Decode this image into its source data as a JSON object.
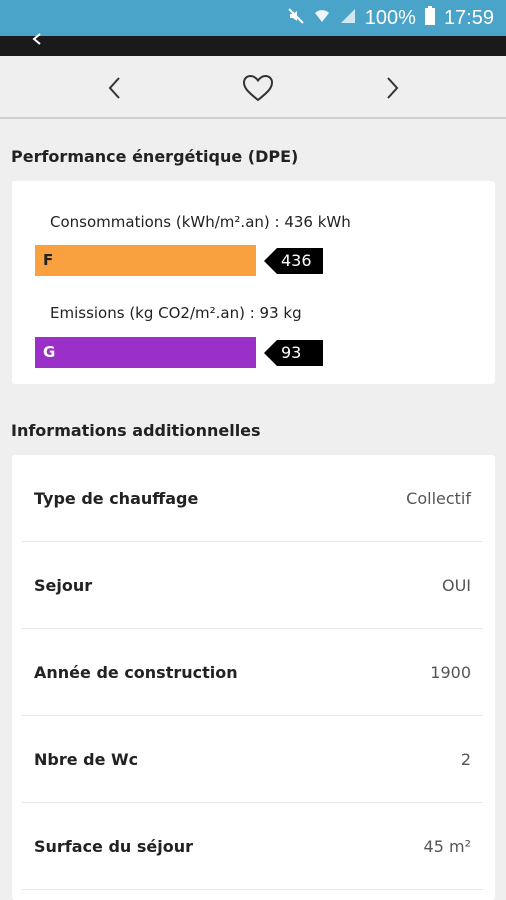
{
  "status_bar": {
    "battery_text": "100%",
    "time": "17:59"
  },
  "icons": {
    "mute": "mute-icon",
    "wifi": "wifi-icon",
    "signal": "signal-icon",
    "battery": "battery-icon",
    "back": "back-arrow-icon",
    "prev": "chevron-left-icon",
    "favorite": "heart-icon",
    "next": "chevron-right-icon"
  },
  "colors": {
    "status_bar": "#4aa3c8",
    "energy_class_F": "#f9a03f",
    "emission_class_G": "#9b30c9"
  },
  "dpe": {
    "title": "Performance énergétique (DPE)",
    "consumption": {
      "label": "Consommations (kWh/m².an) : 436 kWh",
      "class": "F",
      "value": "436"
    },
    "emissions": {
      "label": "Emissions (kg CO2/m².an) : 93 kg",
      "class": "G",
      "value": "93"
    }
  },
  "info": {
    "title": "Informations additionnelles",
    "rows": [
      {
        "key": "Type de chauffage",
        "value": "Collectif"
      },
      {
        "key": "Sejour",
        "value": "OUI"
      },
      {
        "key": "Année de construction",
        "value": "1900"
      },
      {
        "key": "Nbre de Wc",
        "value": "2"
      },
      {
        "key": "Surface du séjour",
        "value": "45 m²"
      }
    ]
  }
}
